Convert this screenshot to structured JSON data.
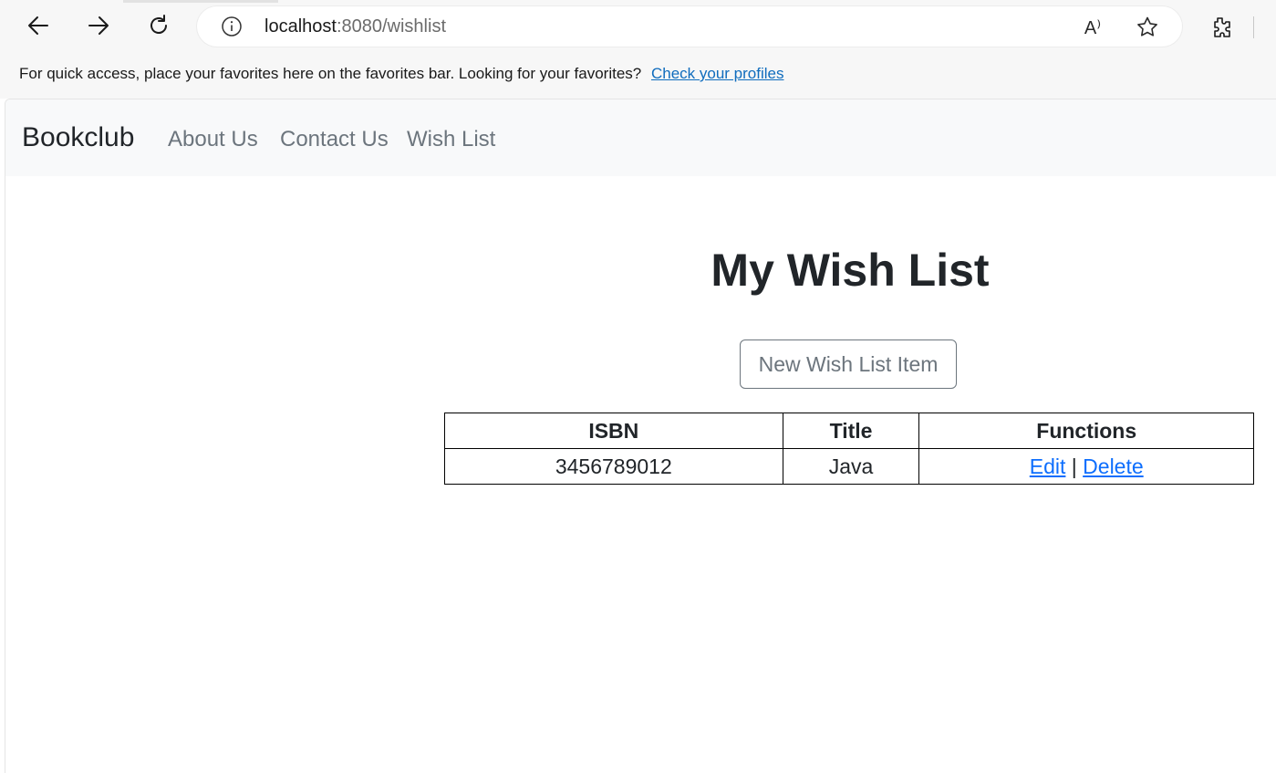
{
  "browser": {
    "url_host": "localhost",
    "url_path": ":8080/wishlist",
    "read_aloud_glyph": "A⁾",
    "favorites_bar": {
      "message": "For quick access, place your favorites here on the favorites bar. Looking for your favorites?",
      "link_label": "Check your profiles"
    },
    "icons": [
      "back-arrow-icon",
      "forward-arrow-icon",
      "refresh-icon",
      "info-icon",
      "read-aloud-icon",
      "favorite-star-icon",
      "extensions-icon"
    ]
  },
  "navbar": {
    "brand": "Bookclub",
    "links": [
      "About Us",
      "Contact Us",
      "Wish List"
    ]
  },
  "main": {
    "title": "My Wish List",
    "new_item_button": "New Wish List Item",
    "table": {
      "headers": [
        "ISBN",
        "Title",
        "Functions"
      ],
      "rows": [
        {
          "isbn": "3456789012",
          "title": "Java",
          "edit_label": "Edit",
          "separator": "|",
          "delete_label": "Delete"
        }
      ]
    }
  },
  "colors": {
    "link": "#0d6efd",
    "nav_link": "#6c757d",
    "navbar_bg": "#f8f9fa",
    "favorites_link": "#0f6cbd"
  }
}
